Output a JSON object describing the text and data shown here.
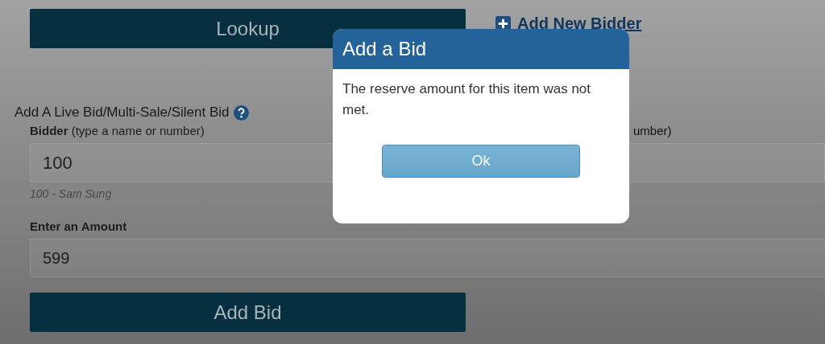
{
  "lookup_button": "Lookup",
  "add_bidder_link": "Add New Bidder",
  "section_title": "Add A Live Bid/Multi-Sale/Silent Bid",
  "bidder_field": {
    "label_bold": "Bidder",
    "label_hint": "(type a name or number)",
    "value": "100",
    "match": "100 - Sam Sung"
  },
  "second_field": {
    "label": "umber)"
  },
  "amount_field": {
    "label": "Enter an Amount",
    "value": "599"
  },
  "add_bid_button": "Add Bid",
  "dialog": {
    "title": "Add a Bid",
    "message": "The reserve amount for this item was not met.",
    "button": "Ok"
  }
}
